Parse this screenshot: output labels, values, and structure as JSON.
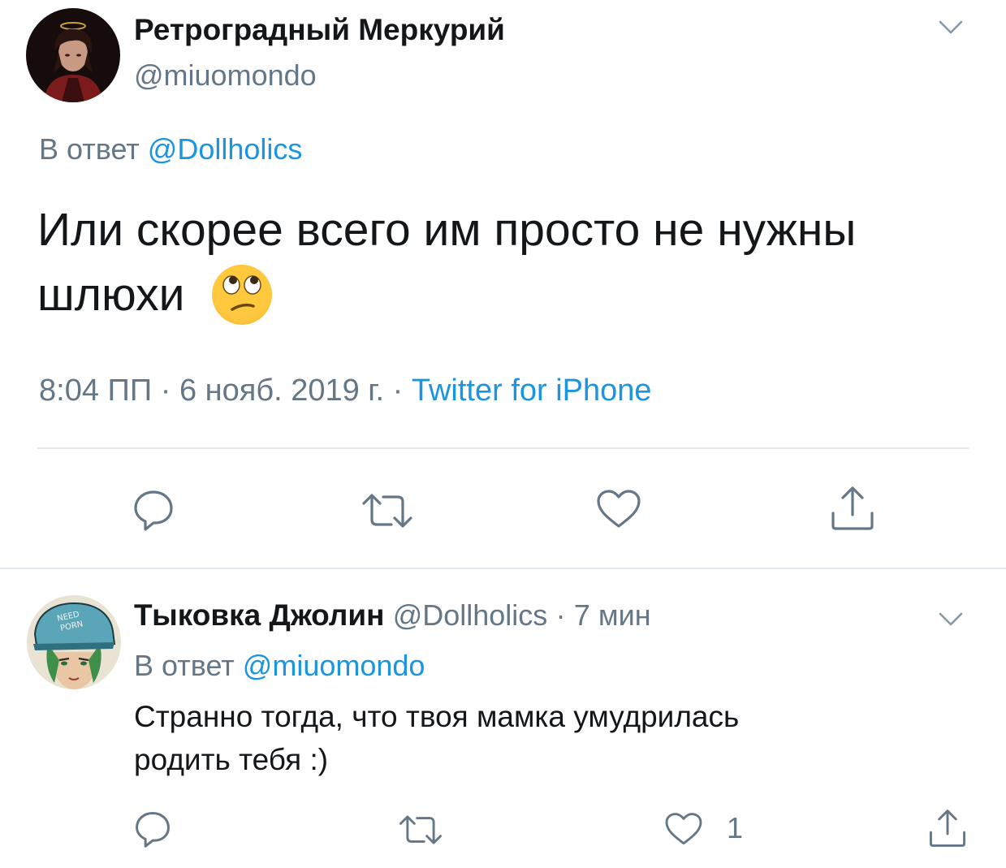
{
  "main_tweet": {
    "author_name": "Ретроградный Меркурий",
    "handle": "@miuomondo",
    "reply_prefix": "В ответ",
    "reply_to": "@Dollholics",
    "text_line1": "Или скорее всего им просто не нужны",
    "text_line2": "шлюхи",
    "emoji": "face-with-rolling-eyes",
    "time": "8:04 ПП",
    "date": "6 нояб. 2019 г.",
    "separator": "·",
    "source": "Twitter for iPhone"
  },
  "reply_tweet": {
    "author_name": "Тыковка Джолин",
    "handle": "@Dollholics",
    "separator": "·",
    "time_ago": "7 мин",
    "reply_prefix": "В ответ",
    "reply_to": "@miuomondo",
    "text_line1": "Странно тогда, что твоя мамка умудрилась",
    "text_line2": "родить тебя :)",
    "like_count": "1",
    "avatar_cap_text": "NEED PORN"
  },
  "icons": [
    "chevron-down-icon",
    "reply-icon",
    "retweet-icon",
    "like-icon",
    "share-icon"
  ],
  "colors": {
    "link": "#1b95e0",
    "muted": "#657786",
    "divider": "#e1e8ed",
    "text": "#14171a"
  }
}
